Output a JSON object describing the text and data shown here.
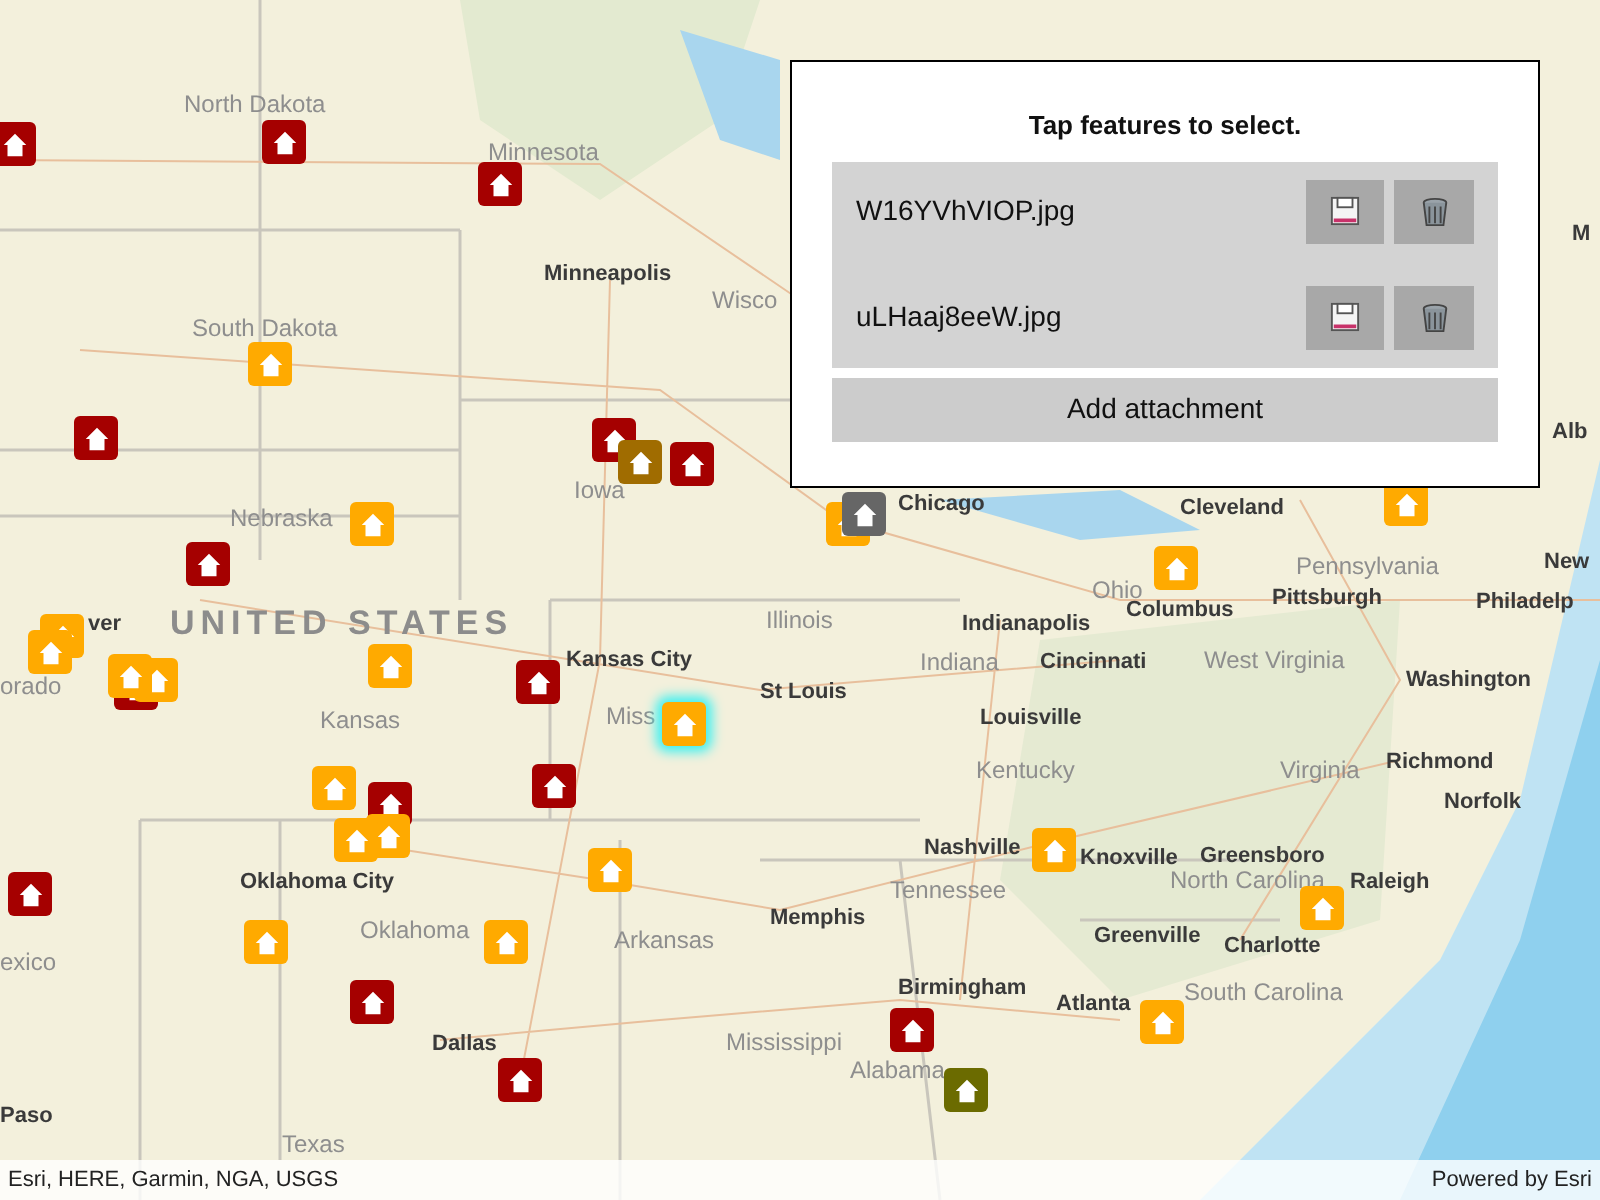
{
  "map": {
    "labels": [
      {
        "text": "North Dakota",
        "kind": "region"
      },
      {
        "text": "Minnesota",
        "kind": "region"
      },
      {
        "text": "M",
        "kind": "city"
      },
      {
        "text": "Minneapolis",
        "kind": "city"
      },
      {
        "text": "Wisco",
        "kind": "region"
      },
      {
        "text": "South Dakota",
        "kind": "region"
      },
      {
        "text": "Alb",
        "kind": "city"
      },
      {
        "text": "Iowa",
        "kind": "region"
      },
      {
        "text": "Chicago",
        "kind": "city"
      },
      {
        "text": "Cleveland",
        "kind": "city"
      },
      {
        "text": "Nebraska",
        "kind": "region"
      },
      {
        "text": "New",
        "kind": "city"
      },
      {
        "text": "Pennsylvania",
        "kind": "region"
      },
      {
        "text": "Ohio",
        "kind": "region"
      },
      {
        "text": "Pittsburgh",
        "kind": "city"
      },
      {
        "text": "Philadelp",
        "kind": "city"
      },
      {
        "text": "ver",
        "kind": "city"
      },
      {
        "text": "UNITED STATES",
        "kind": "country"
      },
      {
        "text": "orado",
        "kind": "region"
      },
      {
        "text": "Kansas City",
        "kind": "city"
      },
      {
        "text": "Illinois",
        "kind": "region"
      },
      {
        "text": "Indianapolis",
        "kind": "city"
      },
      {
        "text": "Columbus",
        "kind": "city"
      },
      {
        "text": "Indiana",
        "kind": "region"
      },
      {
        "text": "Cincinnati",
        "kind": "city"
      },
      {
        "text": "West Virginia",
        "kind": "region"
      },
      {
        "text": "Washington",
        "kind": "city"
      },
      {
        "text": "Kansas",
        "kind": "region"
      },
      {
        "text": "Miss",
        "kind": "region"
      },
      {
        "text": "St Louis",
        "kind": "city"
      },
      {
        "text": "Louisville",
        "kind": "city"
      },
      {
        "text": "Kentucky",
        "kind": "region"
      },
      {
        "text": "Virginia",
        "kind": "region"
      },
      {
        "text": "Richmond",
        "kind": "city"
      },
      {
        "text": "Norfolk",
        "kind": "city"
      },
      {
        "text": "Oklahoma City",
        "kind": "city"
      },
      {
        "text": "Oklahoma",
        "kind": "region"
      },
      {
        "text": "Nashville",
        "kind": "city"
      },
      {
        "text": "Knoxville",
        "kind": "city"
      },
      {
        "text": "Greensboro",
        "kind": "city"
      },
      {
        "text": "Tennessee",
        "kind": "region"
      },
      {
        "text": "North Carolina",
        "kind": "region"
      },
      {
        "text": "Raleigh",
        "kind": "city"
      },
      {
        "text": "Memphis",
        "kind": "city"
      },
      {
        "text": "exico",
        "kind": "region"
      },
      {
        "text": "Arkansas",
        "kind": "region"
      },
      {
        "text": "Greenville",
        "kind": "city"
      },
      {
        "text": "Charlotte",
        "kind": "city"
      },
      {
        "text": "Mississippi",
        "kind": "region"
      },
      {
        "text": "Birmingham",
        "kind": "city"
      },
      {
        "text": "Atlanta",
        "kind": "city"
      },
      {
        "text": "South Carolina",
        "kind": "region"
      },
      {
        "text": "Dallas",
        "kind": "city"
      },
      {
        "text": "Paso",
        "kind": "city"
      },
      {
        "text": "Alabama",
        "kind": "region"
      },
      {
        "text": "Texas",
        "kind": "region"
      }
    ],
    "markers": [
      {
        "color": "#a50000",
        "selected": false
      },
      {
        "color": "#a50000",
        "selected": false
      },
      {
        "color": "#a50000",
        "selected": false
      },
      {
        "color": "#a50000",
        "selected": false
      },
      {
        "color": "#a50000",
        "selected": false
      },
      {
        "color": "#a50000",
        "selected": false
      },
      {
        "color": "#a50000",
        "selected": false
      },
      {
        "color": "#a50000",
        "selected": false
      },
      {
        "color": "#a50000",
        "selected": false
      },
      {
        "color": "#a50000",
        "selected": false
      },
      {
        "color": "#a50000",
        "selected": false
      },
      {
        "color": "#a50000",
        "selected": false
      },
      {
        "color": "#a50000",
        "selected": false
      },
      {
        "color": "#a50000",
        "selected": false
      },
      {
        "color": "#a50000",
        "selected": false
      },
      {
        "color": "#ffaa00",
        "selected": false
      },
      {
        "color": "#ffaa00",
        "selected": false
      },
      {
        "color": "#ffaa00",
        "selected": false
      },
      {
        "color": "#ffaa00",
        "selected": false
      },
      {
        "color": "#ffaa00",
        "selected": false
      },
      {
        "color": "#ffaa00",
        "selected": false
      },
      {
        "color": "#ffaa00",
        "selected": false
      },
      {
        "color": "#ffaa00",
        "selected": false
      },
      {
        "color": "#ffaa00",
        "selected": false
      },
      {
        "color": "#ffaa00",
        "selected": false
      },
      {
        "color": "#ffaa00",
        "selected": false
      },
      {
        "color": "#ffaa00",
        "selected": false
      },
      {
        "color": "#ffaa00",
        "selected": false
      },
      {
        "color": "#ffaa00",
        "selected": true
      },
      {
        "color": "#ffaa00",
        "selected": false
      },
      {
        "color": "#ffaa00",
        "selected": false
      },
      {
        "color": "#ffaa00",
        "selected": false
      },
      {
        "color": "#ffaa00",
        "selected": false
      },
      {
        "color": "#ffaa00",
        "selected": false
      },
      {
        "color": "#ffaa00",
        "selected": false
      },
      {
        "color": "#a06c00",
        "selected": false
      },
      {
        "color": "#666666",
        "selected": false
      },
      {
        "color": "#6b6b00",
        "selected": false
      }
    ]
  },
  "panel": {
    "title": "Tap features to select.",
    "attachments": [
      {
        "name": "W16YVhVIOP.jpg"
      },
      {
        "name": "uLHaaj8eeW.jpg"
      }
    ],
    "add_button": "Add attachment"
  },
  "attribution": {
    "sources": "Esri, HERE, Garmin, NGA, USGS",
    "powered_by": "Powered by Esri"
  }
}
